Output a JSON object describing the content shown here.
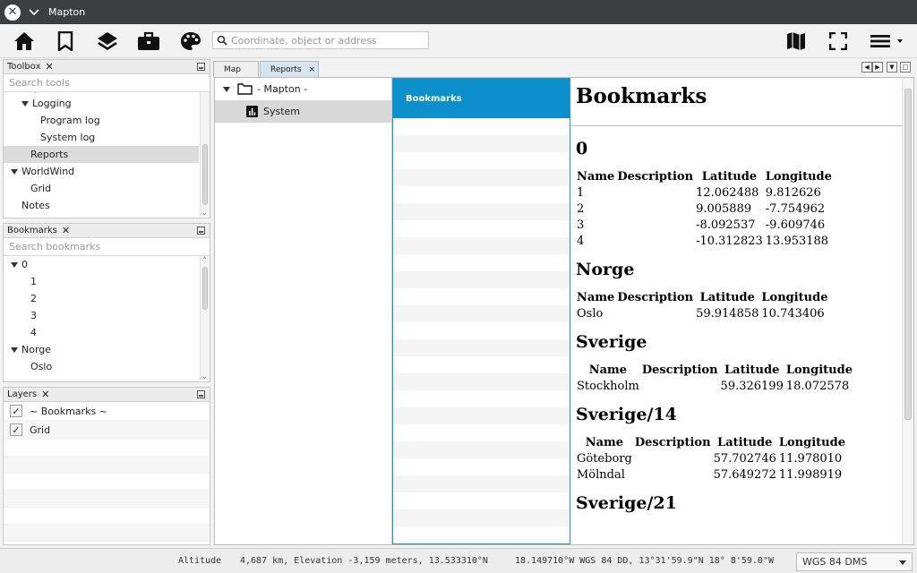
{
  "window": {
    "title": "Mapton"
  },
  "toolbar": {
    "icons": [
      "home-icon",
      "bookmark-icon",
      "layers-icon",
      "toolbox-icon",
      "palette-icon",
      "map-icon",
      "fullscreen-icon",
      "menu-icon"
    ],
    "search_placeholder": "Coordinate, object or address"
  },
  "toolbox": {
    "title": "Toolbox",
    "close": "✕",
    "filter_placeholder": "Search tools",
    "items": [
      {
        "label": "Logging",
        "level": 1,
        "expanded": true
      },
      {
        "label": "Program log",
        "level": 2
      },
      {
        "label": "System log",
        "level": 2
      },
      {
        "label": "Reports",
        "level": 1,
        "selected": true
      },
      {
        "label": "WorldWind",
        "level": 0,
        "expanded": true
      },
      {
        "label": "Grid",
        "level": 1
      },
      {
        "label": "Notes",
        "level": 0
      }
    ]
  },
  "bookmarks_panel": {
    "title": "Bookmarks",
    "close": "✕",
    "filter_placeholder": "Search bookmarks",
    "items": [
      {
        "label": "0",
        "level": 0,
        "expanded": true
      },
      {
        "label": "1",
        "level": 1
      },
      {
        "label": "2",
        "level": 1
      },
      {
        "label": "3",
        "level": 1
      },
      {
        "label": "4",
        "level": 1
      },
      {
        "label": "Norge",
        "level": 0,
        "expanded": true
      },
      {
        "label": "Oslo",
        "level": 1
      }
    ]
  },
  "layers": {
    "title": "Layers",
    "close": "✕",
    "items": [
      {
        "label": "~ Bookmarks ~",
        "checked": true
      },
      {
        "label": "Grid",
        "checked": true
      }
    ]
  },
  "tabs": [
    {
      "label": "Map",
      "active": false
    },
    {
      "label": "Reports",
      "active": true,
      "close": "×"
    }
  ],
  "nav_tree": {
    "root": "- Mapton -",
    "items": [
      {
        "label": "System",
        "selected": true
      }
    ]
  },
  "categories": {
    "selected": "Bookmarks"
  },
  "report": {
    "title": "Bookmarks",
    "columns": [
      "Name",
      "Description",
      "Latitude",
      "Longitude"
    ],
    "sections": [
      {
        "heading": "0",
        "rows": [
          [
            "1",
            "",
            "12.062488",
            "9.812626"
          ],
          [
            "2",
            "",
            "9.005889",
            "-7.754962"
          ],
          [
            "3",
            "",
            "-8.092537",
            "-9.609746"
          ],
          [
            "4",
            "",
            "-10.312823",
            "13.953188"
          ]
        ]
      },
      {
        "heading": "Norge",
        "rows": [
          [
            "Oslo",
            "",
            "59.914858",
            "10.743406"
          ]
        ]
      },
      {
        "heading": "Sverige",
        "rows": [
          [
            "Stockholm",
            "",
            "59.326199",
            "18.072578"
          ]
        ]
      },
      {
        "heading": "Sverige/14",
        "rows": [
          [
            "Göteborg",
            "",
            "57.702746",
            "11.978010"
          ],
          [
            "Mölndal",
            "",
            "57.649272",
            "11.998919"
          ]
        ]
      },
      {
        "heading": "Sverige/21",
        "rows": []
      }
    ]
  },
  "status": {
    "label": "Altitude",
    "altitude": "4,687 km, Elevation -3,159 meters, 13.533310°N",
    "coords": "18.149710°W WGS 84 DD, 13°31'59.9\"N  18° 8'59.0\"W",
    "crs": "WGS 84 DMS"
  }
}
